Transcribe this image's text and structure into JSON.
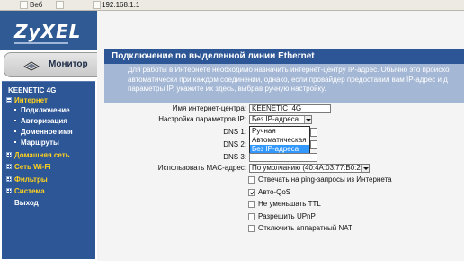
{
  "browser": {
    "tab1_label": "Веб",
    "url": "192.168.1.1"
  },
  "brand": {
    "logo": "ZyXEL"
  },
  "sidebar": {
    "monitor_label": "Монитор",
    "device": "KEENETIC 4G",
    "items": [
      {
        "label": "Интернет",
        "type": "top",
        "state": "expanded"
      },
      {
        "label": "Подключение",
        "type": "sub"
      },
      {
        "label": "Авторизация",
        "type": "sub"
      },
      {
        "label": "Доменное имя",
        "type": "sub"
      },
      {
        "label": "Маршруты",
        "type": "sub"
      },
      {
        "label": "Домашняя сеть",
        "type": "top",
        "state": "collapsed"
      },
      {
        "label": "Сеть Wi-Fi",
        "type": "top",
        "state": "collapsed"
      },
      {
        "label": "Фильтры",
        "type": "top",
        "state": "collapsed"
      },
      {
        "label": "Система",
        "type": "top",
        "state": "collapsed"
      },
      {
        "label": "Выход",
        "type": "plain"
      }
    ]
  },
  "page": {
    "title": "Подключение по выделенной линии Ethernet",
    "description": [
      "Для работы в Интернете необходимо назначить интернет-центру IP-адрес. Обычно это происхо",
      "автоматически при каждом соединении, однако, если провайдер предоставил вам IP-адрес и д",
      "параметры IP, укажите их здесь, выбрав ручную настройку."
    ]
  },
  "form": {
    "hostname_label": "Имя интернет-центра:",
    "hostname_value": "KEENETIC_4G",
    "ip_label": "Настройка параметров IP:",
    "ip_value": "Без IP-адреса",
    "ip_options": [
      "Ручная",
      "Автоматическая",
      "Без IP-адреса"
    ],
    "dns1_label": "DNS 1:",
    "dns2_label": "DNS 2:",
    "dns3_label": "DNS 3:",
    "mac_label": "Использовать МАС-адрес:",
    "mac_value": "По умолчанию (40:4A:03:77:B0:24)",
    "checkboxes": [
      {
        "label": "Отвечать на ping-запросы из Интернета",
        "checked": false
      },
      {
        "label": "Авто-QoS",
        "checked": true
      },
      {
        "label": "Не уменьшать TTL",
        "checked": false
      },
      {
        "label": "Разрешить UPnP",
        "checked": false
      },
      {
        "label": "Отключить аппаратный NAT",
        "checked": false
      }
    ]
  }
}
